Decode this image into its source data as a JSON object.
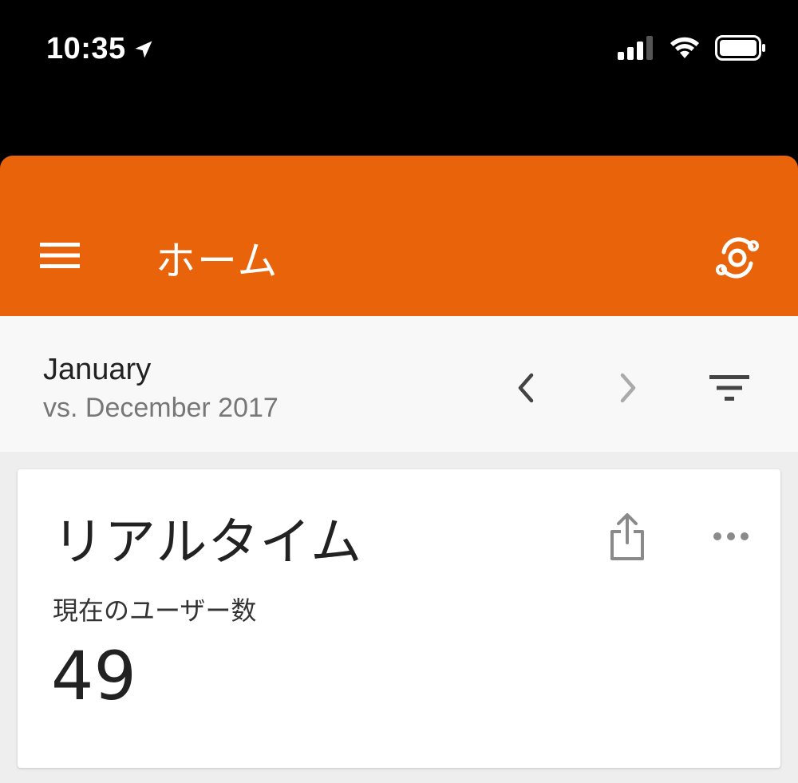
{
  "status_bar": {
    "time": "10:35",
    "icons": [
      "location-arrow-icon",
      "cellular-signal-icon",
      "wifi-icon",
      "battery-icon"
    ]
  },
  "app_bar": {
    "title": "ホーム",
    "menu_icon": "hamburger-menu-icon",
    "action_icon": "intelligence-icon",
    "background_color": "#e8630a"
  },
  "date_bar": {
    "period": "January",
    "comparison": "vs. December 2017",
    "icons": [
      "chevron-left-icon",
      "chevron-right-icon",
      "filter-icon"
    ]
  },
  "card": {
    "title": "リアルタイム",
    "metric_label": "現在のユーザー数",
    "metric_value": "49",
    "icons": [
      "share-icon",
      "more-horizontal-icon"
    ]
  }
}
